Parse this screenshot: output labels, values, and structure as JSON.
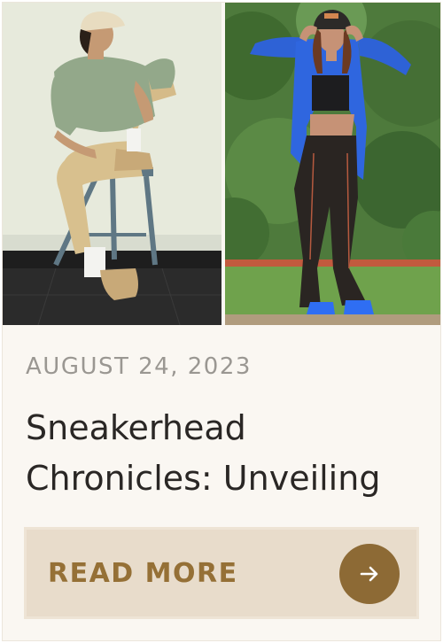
{
  "post": {
    "date": "AUGUST 24, 2023",
    "title": "Sneakerhead Chronicles: Unveiling",
    "read_more_label": "READ MORE"
  },
  "images": {
    "left": "man-sitting-on-stool-photo",
    "right": "woman-in-blue-jacket-photo"
  },
  "icons": {
    "read_more_button": "arrow-right-icon"
  },
  "colors": {
    "card_background": "#faf7f2",
    "date_text": "#9a9792",
    "title_text": "#2a2725",
    "button_background": "#e8dccb",
    "button_text": "#957036",
    "arrow_circle": "#8d6a35"
  }
}
